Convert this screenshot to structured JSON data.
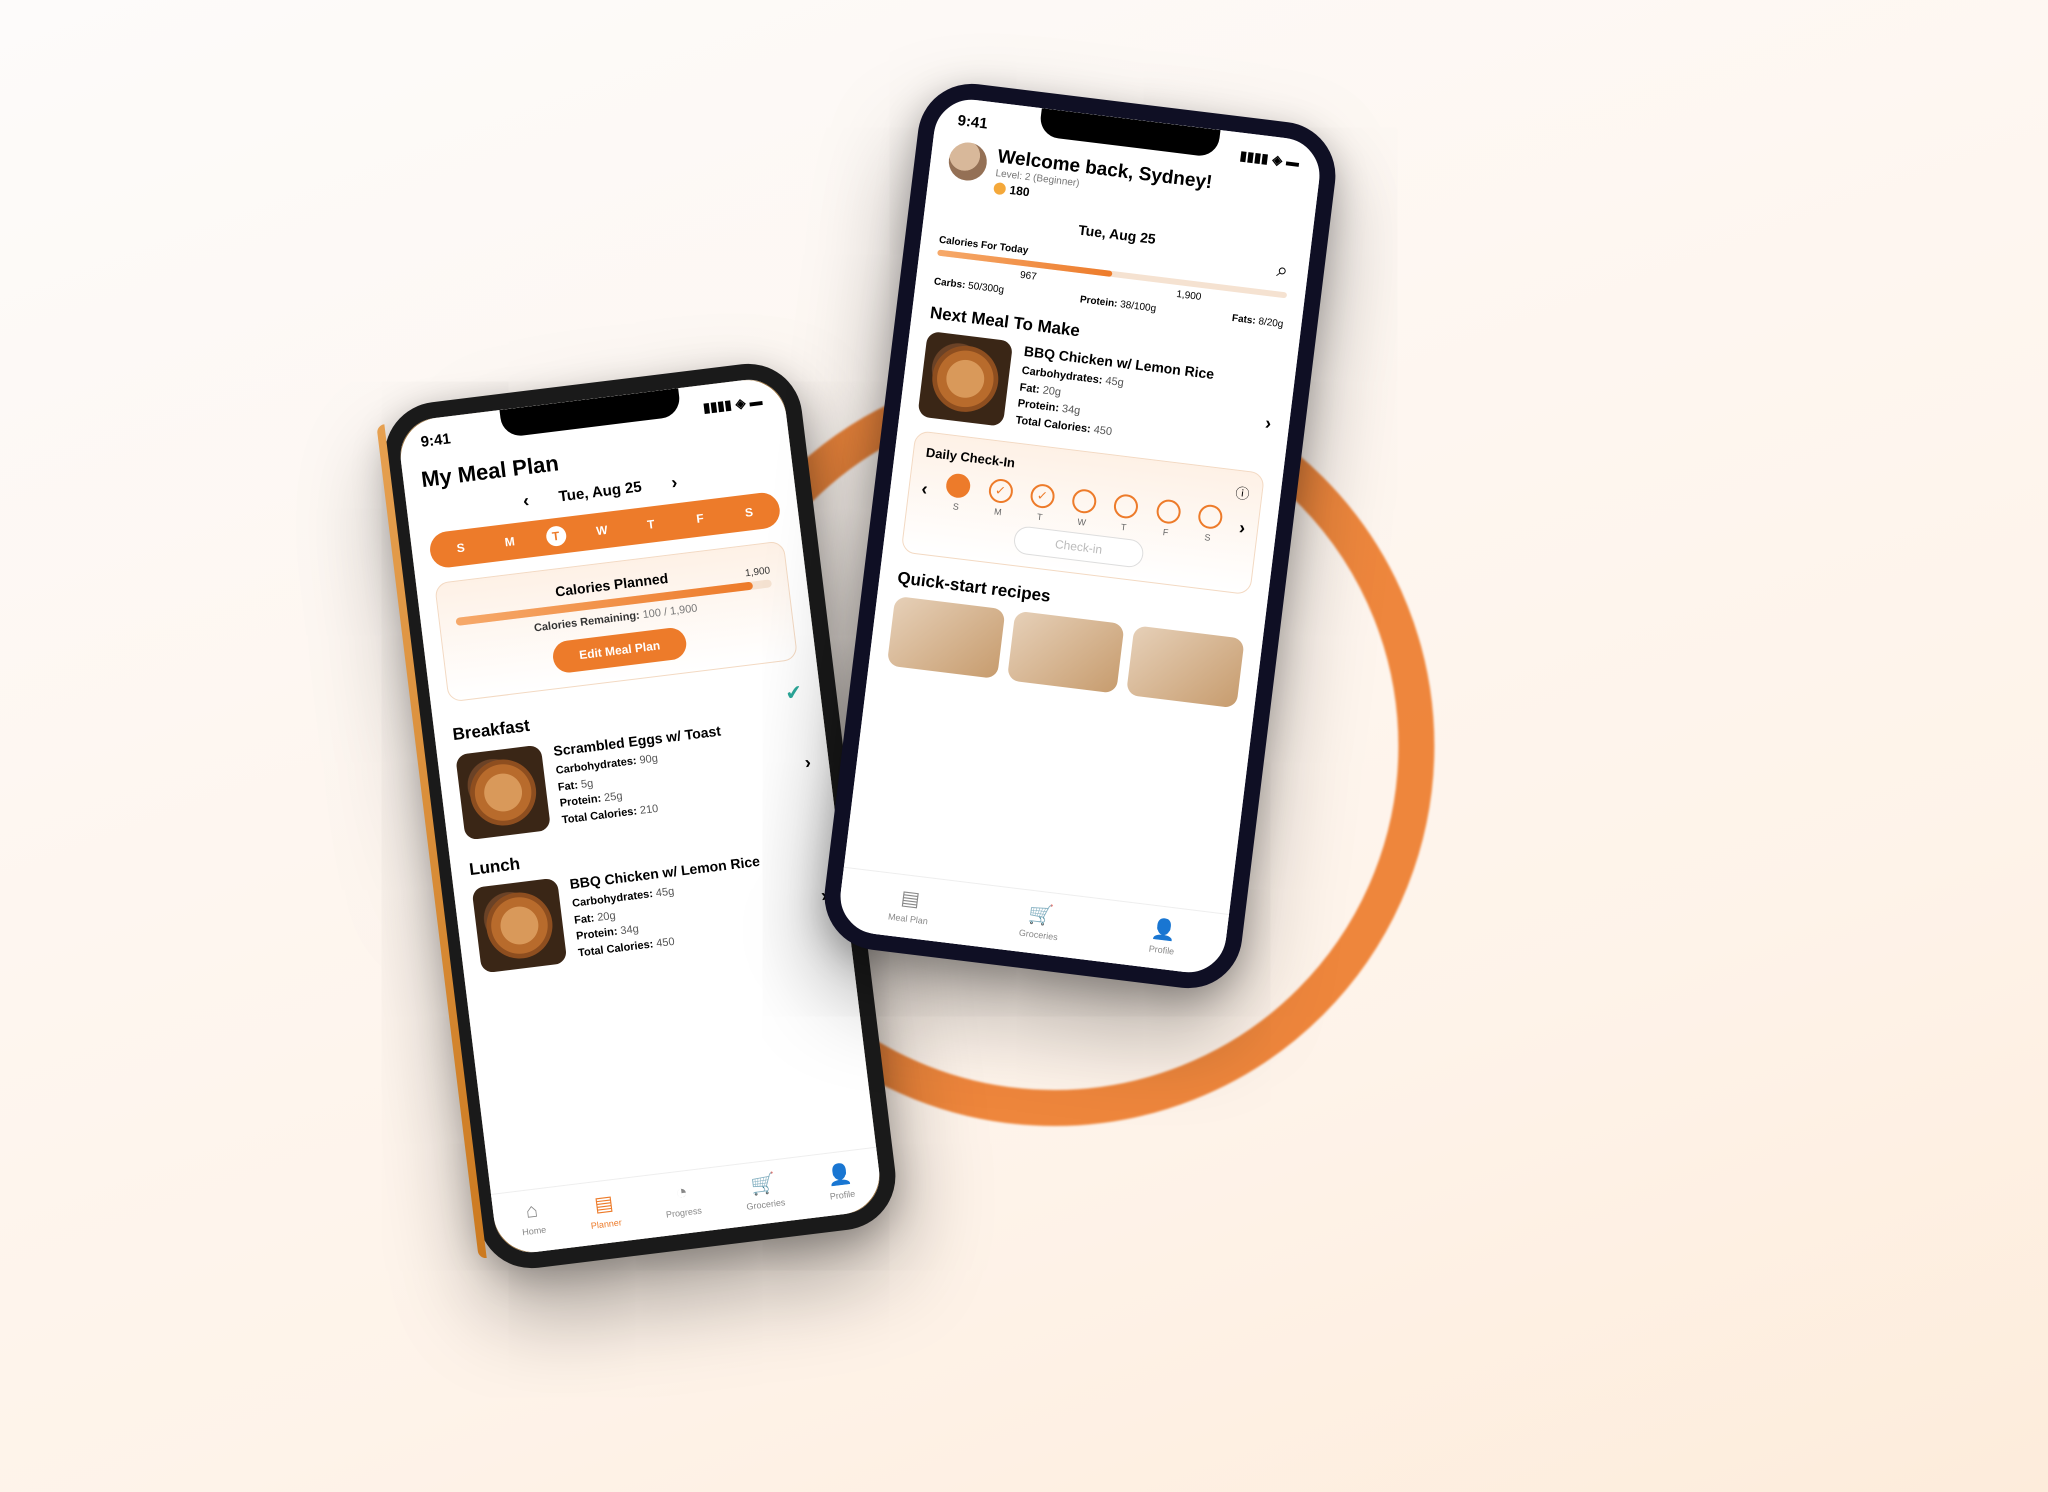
{
  "status_time": "9:41",
  "left": {
    "title": "My Meal Plan",
    "date": "Tue, Aug 25",
    "days": [
      "S",
      "M",
      "T",
      "W",
      "T",
      "F",
      "S"
    ],
    "calories_card": {
      "title": "Calories Planned",
      "max": "1,900",
      "remaining_label": "Calories Remaining:",
      "remaining_value": "100 / 1,900",
      "button": "Edit Meal Plan"
    },
    "meals": {
      "breakfast": {
        "heading": "Breakfast",
        "name": "Scrambled Eggs w/ Toast",
        "carbs_label": "Carbohydrates:",
        "carbs": "90g",
        "fat_label": "Fat:",
        "fat": "5g",
        "protein_label": "Protein:",
        "protein": "25g",
        "cal_label": "Total Calories:",
        "cal": "210"
      },
      "lunch": {
        "heading": "Lunch",
        "name": "BBQ Chicken w/ Lemon Rice",
        "carbs_label": "Carbohydrates:",
        "carbs": "45g",
        "fat_label": "Fat:",
        "fat": "20g",
        "protein_label": "Protein:",
        "protein": "34g",
        "cal_label": "Total Calories:",
        "cal": "450"
      }
    },
    "tabs": [
      "Home",
      "Planner",
      "Progress",
      "Groceries",
      "Profile"
    ]
  },
  "right": {
    "welcome": "Welcome back, Sydney!",
    "level": "Level: 2 (Beginner)",
    "points": "180",
    "date": "Tue, Aug 25",
    "calories_label": "Calories For Today",
    "calories_value": "967",
    "calories_max": "1,900",
    "macros": {
      "carbs_label": "Carbs:",
      "carbs": "50/300g",
      "protein_label": "Protein:",
      "protein": "38/100g",
      "fats_label": "Fats:",
      "fats": "8/20g"
    },
    "next_meal_heading": "Next Meal To Make",
    "next_meal": {
      "name": "BBQ Chicken w/ Lemon Rice",
      "carbs_label": "Carbohydrates:",
      "carbs": "45g",
      "fat_label": "Fat:",
      "fat": "20g",
      "protein_label": "Protein:",
      "protein": "34g",
      "cal_label": "Total Calories:",
      "cal": "450"
    },
    "checkin": {
      "title": "Daily Check-In",
      "days": [
        "S",
        "M",
        "T",
        "W",
        "T",
        "F",
        "S"
      ],
      "button": "Check-in"
    },
    "quickstart": "Quick-start recipes",
    "tabs": [
      "Meal Plan",
      "Groceries",
      "Profile"
    ]
  }
}
